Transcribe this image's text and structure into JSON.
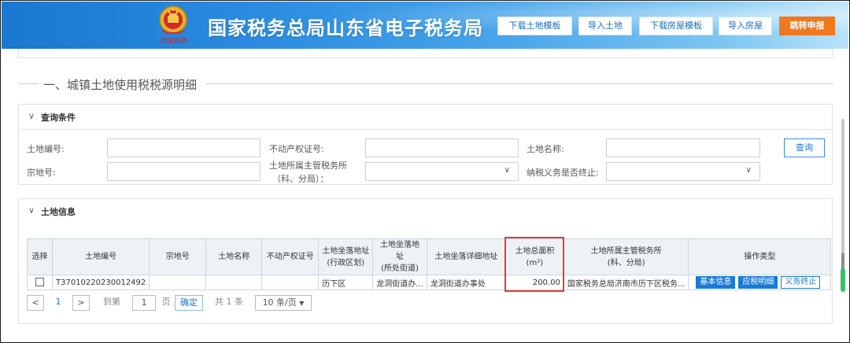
{
  "header": {
    "title": "国家税务总局山东省电子税务局",
    "emblem_text": "中国税务",
    "buttons": [
      {
        "label": "下载土地模板"
      },
      {
        "label": "导入土地"
      },
      {
        "label": "下载房屋模板"
      },
      {
        "label": "导入房屋"
      },
      {
        "label": "跳转申报"
      }
    ]
  },
  "section": {
    "title": "一、城镇土地使用税税源明细"
  },
  "query": {
    "title": "查询条件",
    "fields": {
      "land_no": {
        "label": "土地编号:",
        "value": ""
      },
      "property_cert": {
        "label": "不动产权证号:",
        "value": ""
      },
      "land_name": {
        "label": "土地名称:",
        "value": ""
      },
      "parcel_no": {
        "label": "宗地号:",
        "value": ""
      },
      "tax_office": {
        "label_line1": "土地所属主管税务所",
        "label_line2": "（科、分局）：",
        "value": ""
      },
      "terminated": {
        "label": "纳税义务是否终止:",
        "value": ""
      }
    },
    "query_button": "查询"
  },
  "land_info": {
    "title": "土地信息",
    "columns": {
      "select": "选择",
      "land_no": "土地编号",
      "parcel_no": "宗地号",
      "land_name": "土地名称",
      "cert_no": "不动产权证号",
      "addr_district_1": "土地坐落地址",
      "addr_district_2": "(行政区划)",
      "addr_street_1": "土地坐落地址",
      "addr_street_2": "(所处街道)",
      "addr_detail": "土地坐落详细地址",
      "area_1": "土地总面积",
      "area_2": "(m²)",
      "office_1": "土地所属主管税务所",
      "office_2": "(科、分局)",
      "ops": "操作类型"
    },
    "rows": [
      {
        "land_no": "T37010220230012492",
        "parcel_no": "",
        "land_name": "",
        "cert_no": "",
        "district": "历下区",
        "street": "龙洞街道办...",
        "detail": "龙洞街道办事处",
        "area": "200.00",
        "office": "国家税务总局济南市历下区税务...",
        "ops": [
          "基本信息",
          "应税明细",
          "义务终止"
        ]
      }
    ]
  },
  "pager": {
    "prev": "<",
    "current": "1",
    "next": ">",
    "goto_label": "到第",
    "goto_value": "1",
    "page_unit": "页",
    "confirm": "确定",
    "total": "共 1 条",
    "page_size": "10 条/页"
  },
  "colors": {
    "accent": "#1a7ad8",
    "orange": "#f0781e",
    "highlight": "#e23b3b"
  }
}
